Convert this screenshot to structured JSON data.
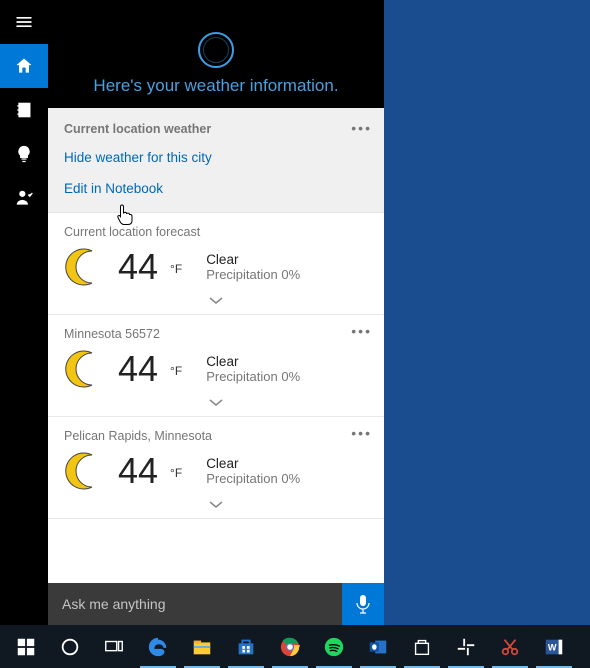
{
  "header": {
    "title": "Here's your weather information."
  },
  "card": {
    "title": "Current location weather",
    "hide_link": "Hide weather for this city",
    "edit_link": "Edit in Notebook"
  },
  "forecasts": [
    {
      "location": "Current location forecast",
      "temp": "44",
      "unit": "°F",
      "condition": "Clear",
      "precip": "Precipitation 0%",
      "show_dots": false
    },
    {
      "location": "Minnesota 56572",
      "temp": "44",
      "unit": "°F",
      "condition": "Clear",
      "precip": "Precipitation 0%",
      "show_dots": true
    },
    {
      "location": "Pelican Rapids, Minnesota",
      "temp": "44",
      "unit": "°F",
      "condition": "Clear",
      "precip": "Precipitation 0%",
      "show_dots": true
    }
  ],
  "search": {
    "placeholder": "Ask me anything"
  }
}
